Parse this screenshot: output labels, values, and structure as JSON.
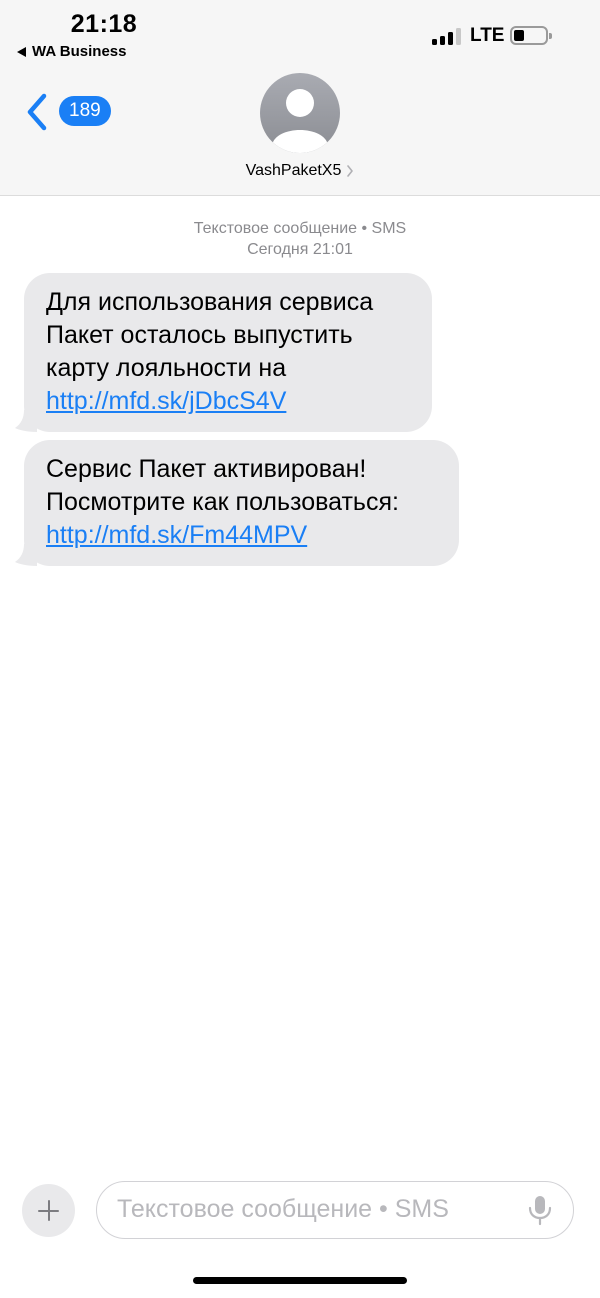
{
  "status_bar": {
    "time": "21:18",
    "back_app": "WA Business",
    "network": "LTE"
  },
  "header": {
    "unread_count": "189",
    "contact_name": "VashPaketX5"
  },
  "thread": {
    "meta_line1": "Текстовое сообщение • SMS",
    "meta_line2": "Сегодня 21:01",
    "messages": [
      {
        "text": "Для использования сервиса Пакет осталось выпустить карту лояльности на ",
        "link": "http://mfd.sk/jDbcS4V"
      },
      {
        "text": "Сервис Пакет активирован! Посмотрите как пользоваться: ",
        "link": "http://mfd.sk/Fm44MPV"
      }
    ]
  },
  "composer": {
    "placeholder": "Текстовое сообщение • SMS"
  },
  "colors": {
    "accent": "#1a7ff5",
    "bubble": "#e9e9eb",
    "meta_text": "#8a8a8e"
  },
  "icons": [
    "signal-icon",
    "battery-icon",
    "back-chevron-icon",
    "avatar-person-icon",
    "chevron-right-icon",
    "plus-icon",
    "mic-icon"
  ]
}
